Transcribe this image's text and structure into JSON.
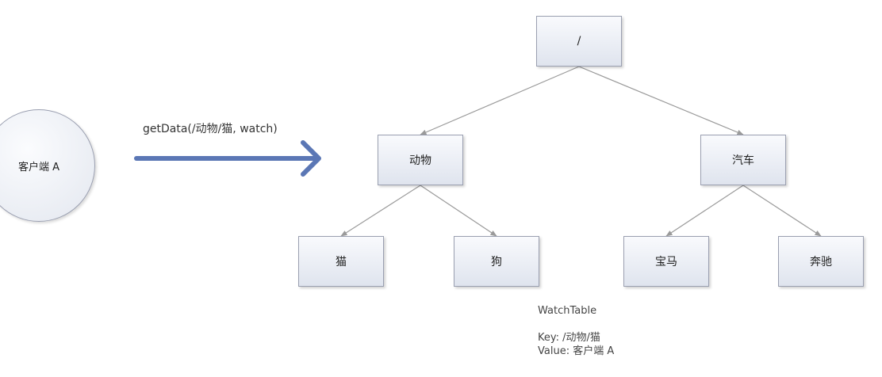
{
  "client": {
    "label": "客户端 A"
  },
  "call": {
    "label": "getData(/动物/猫, watch)"
  },
  "tree": {
    "root": "/",
    "level1": [
      "动物",
      "汽车"
    ],
    "level2": [
      "猫",
      "狗",
      "宝马",
      "奔驰"
    ]
  },
  "watch_table": {
    "title": "WatchTable",
    "key_label": "Key:",
    "key_value": "/动物/猫",
    "value_label": "Value:",
    "value_value": "客户端 A"
  },
  "colors": {
    "arrow": "#5b77b5",
    "connector": "#9a9a9a",
    "box_border": "#9a9fb0"
  }
}
